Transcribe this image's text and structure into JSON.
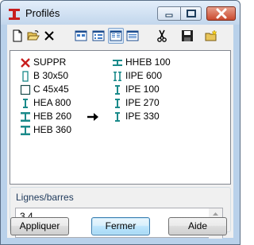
{
  "window": {
    "title": "Profilés"
  },
  "toolbar": {
    "buttons": [
      {
        "icon": "new-document-icon"
      },
      {
        "icon": "open-folder-icon"
      },
      {
        "icon": "delete-x-icon"
      },
      {
        "icon": "large-icons-view-icon"
      },
      {
        "icon": "small-icons-view-icon"
      },
      {
        "icon": "list-view-icon",
        "active": true
      },
      {
        "icon": "details-view-icon"
      },
      {
        "icon": "cut-scissors-icon"
      },
      {
        "icon": "save-disk-icon"
      },
      {
        "icon": "new-folder-icon"
      }
    ]
  },
  "profiles": {
    "column1": [
      {
        "label": "SUPPR",
        "icon": "delete-red-x-icon"
      },
      {
        "label": "B 30x50",
        "icon": "rectangle-section-icon"
      },
      {
        "label": "C 45x45",
        "icon": "square-section-icon"
      },
      {
        "label": "HEA 800",
        "icon": "i-beam-section-icon"
      },
      {
        "label": "HEB 260",
        "icon": "h-beam-section-icon"
      },
      {
        "label": "HEB 360",
        "icon": "h-beam-section-icon"
      }
    ],
    "column2": [
      {
        "label": "HHEB 100",
        "icon": "flat-beam-section-icon"
      },
      {
        "label": "IIPE 600",
        "icon": "double-i-section-icon"
      },
      {
        "label": "IPE 100",
        "icon": "i-beam-section-icon"
      },
      {
        "label": "IPE 270",
        "icon": "i-beam-section-icon"
      },
      {
        "label": "IPE 330",
        "icon": "i-beam-section-icon",
        "current": true
      }
    ]
  },
  "lines_group": {
    "label": "Lignes/barres",
    "value": "3 4"
  },
  "buttons": {
    "apply": "Appliquer",
    "close": "Fermer",
    "help": "Aide"
  },
  "colors": {
    "accent_teal": "#1a8a8a",
    "delete_red": "#c81e1e"
  }
}
